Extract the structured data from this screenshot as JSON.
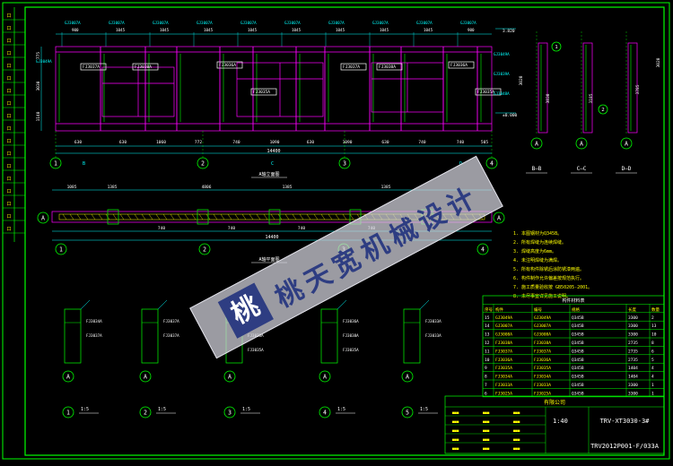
{
  "colors": {
    "bg": "#000000",
    "frame": "#00ff00",
    "wall": "#ff00ff",
    "profile": "#00ff00",
    "dim": "#00ffff",
    "text": "#ffffff",
    "accent": "#ffff00",
    "hatch": "#ffff00",
    "watermark_bg": "#d8d8e0",
    "watermark_fg": "#2e3d82"
  },
  "elevation": {
    "top_codes": [
      "GJ3007A",
      "GJ3007A",
      "GJ3007A",
      "GJ3007A",
      "GJ3007A",
      "GJ3007A",
      "GJ3007A",
      "GJ3007A",
      "GJ3007A",
      "GJ3007A"
    ],
    "top_dims": [
      "900",
      "1045",
      "1045",
      "1045",
      "1045",
      "1045",
      "1045",
      "1045",
      "1045",
      "900"
    ],
    "panel_labels": [
      "FJ3037A",
      "FJ3038A",
      "FJ3036A",
      "FJ3035A",
      "FJ3037A",
      "FJ3038A",
      "FJ3036A",
      "FJ3035A"
    ],
    "bottom_dims": [
      "630",
      "630",
      "1060",
      "772",
      "740",
      "1090",
      "630",
      "1090",
      "630",
      "740",
      "740",
      "505"
    ],
    "total": "14400",
    "grid": [
      "1",
      "2",
      "3",
      "4"
    ],
    "section_letters": [
      "B",
      "C",
      "D"
    ],
    "levels": [
      "3.820",
      "±0.000"
    ],
    "left_dims": [
      "775",
      "3030",
      "1140"
    ],
    "side_codes": [
      "GJ3049A",
      "GJ3039A",
      "GJ3048A"
    ],
    "caption": "A轴立面图"
  },
  "plan": {
    "dims_top": [
      "1085",
      "1385",
      "4806",
      "1385",
      "1385"
    ],
    "dims_bottom": [
      "740",
      "740",
      "740",
      "740"
    ],
    "total": "14400",
    "grid": [
      "1",
      "2",
      "3",
      "4"
    ],
    "axis": "A",
    "caption": "A轴平面图"
  },
  "sections": [
    {
      "label": "B—B"
    },
    {
      "label": "C—C"
    },
    {
      "label": "D—D"
    }
  ],
  "side_dims": [
    "3830",
    "3185",
    "3785",
    "3020",
    "3020"
  ],
  "notes": {
    "lines": [
      "1. 本图钢材为Q345B。",
      "2. 所有焊缝为连续焊缝。",
      "3. 焊缝高度为6mm。",
      "4. 未注明焊缝为满焊。",
      "5. 所有构件除锈后涂防锈漆两遍。",
      "6. 构件制作允许偏差按规范执行。",
      "7. 施工质量验收按 GB50205-2001。",
      "8. 未尽事宜详见施工说明。"
    ]
  },
  "table": {
    "title": "构件材料表",
    "headers": [
      "序号",
      "构件",
      "编号",
      "规格",
      "长度",
      "数量"
    ],
    "rows": [
      [
        "15",
        "GJ3049A",
        "GJ3049A",
        "Q345B",
        "3300",
        "2"
      ],
      [
        "14",
        "GJ3007A",
        "GJ3007A",
        "Q345B",
        "3300",
        "13"
      ],
      [
        "13",
        "GJ3008A",
        "GJ3008A",
        "Q345B",
        "3300",
        "10"
      ],
      [
        "12",
        "FJ3038A",
        "FJ3038A",
        "Q345B",
        "2735",
        "8"
      ],
      [
        "11",
        "FJ3037A",
        "FJ3037A",
        "Q345B",
        "2735",
        "6"
      ],
      [
        "10",
        "FJ3036A",
        "FJ3036A",
        "Q345B",
        "2735",
        "5"
      ],
      [
        "9",
        "FJ3035A",
        "FJ3035A",
        "Q345B",
        "1404",
        "4"
      ],
      [
        "8",
        "FJ3034A",
        "FJ3034A",
        "Q345B",
        "1404",
        "4"
      ],
      [
        "7",
        "FJ3033A",
        "FJ3033A",
        "Q345B",
        "3300",
        "1"
      ],
      [
        "6",
        "FJ3025A",
        "FJ3025A",
        "Q345B",
        "3300",
        "1"
      ]
    ]
  },
  "details": [
    {
      "num": "1",
      "scale": "1:5",
      "codes": [
        "FJ3034A",
        "FJ3037A"
      ]
    },
    {
      "num": "2",
      "scale": "1:5",
      "codes": [
        "FJ3037A",
        "FJ3037A"
      ]
    },
    {
      "num": "3",
      "scale": "1:5",
      "codes": [
        "FJ3036A",
        "FJ3038A",
        "FJ3035A"
      ]
    },
    {
      "num": "4",
      "scale": "1:5",
      "codes": [
        "FJ3036A",
        "FJ3038A",
        "FJ3035A"
      ]
    },
    {
      "num": "5",
      "scale": "1:5",
      "codes": [
        "FJ3033A",
        "FJ3033A"
      ]
    }
  ],
  "title_block": {
    "company": "有限公司",
    "scale": "1:40",
    "project": "TRV-XT3030-3#",
    "drawing": "TRV2012P001-F/033A"
  },
  "watermark": {
    "badge": "桃",
    "text": "桃天宽机械设计"
  }
}
